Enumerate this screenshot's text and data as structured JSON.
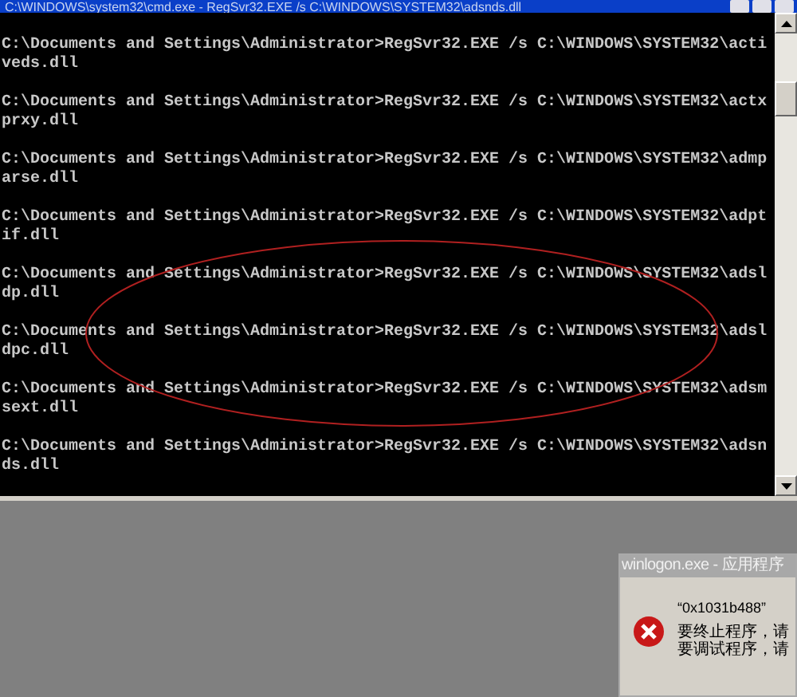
{
  "window": {
    "title": "C:\\WINDOWS\\system32\\cmd.exe - RegSvr32.EXE /s C:\\WINDOWS\\SYSTEM32\\adsnds.dll"
  },
  "console": {
    "lines": [
      "C:\\Documents and Settings\\Administrator>RegSvr32.EXE /s C:\\WINDOWS\\SYSTEM32\\acti",
      "veds.dll",
      "C:\\Documents and Settings\\Administrator>RegSvr32.EXE /s C:\\WINDOWS\\SYSTEM32\\actx",
      "prxy.dll",
      "C:\\Documents and Settings\\Administrator>RegSvr32.EXE /s C:\\WINDOWS\\SYSTEM32\\admp",
      "arse.dll",
      "C:\\Documents and Settings\\Administrator>RegSvr32.EXE /s C:\\WINDOWS\\SYSTEM32\\adpt",
      "if.dll",
      "C:\\Documents and Settings\\Administrator>RegSvr32.EXE /s C:\\WINDOWS\\SYSTEM32\\adsl",
      "dp.dll",
      "C:\\Documents and Settings\\Administrator>RegSvr32.EXE /s C:\\WINDOWS\\SYSTEM32\\adsl",
      "dpc.dll",
      "C:\\Documents and Settings\\Administrator>RegSvr32.EXE /s C:\\WINDOWS\\SYSTEM32\\adsm",
      "sext.dll",
      "C:\\Documents and Settings\\Administrator>RegSvr32.EXE /s C:\\WINDOWS\\SYSTEM32\\adsn",
      "ds.dll"
    ]
  },
  "dialog": {
    "title": "winlogon.exe - 应用程序",
    "message": [
      "“0x1031b488”",
      "要终止程序，请",
      "要调试程序，请"
    ]
  }
}
